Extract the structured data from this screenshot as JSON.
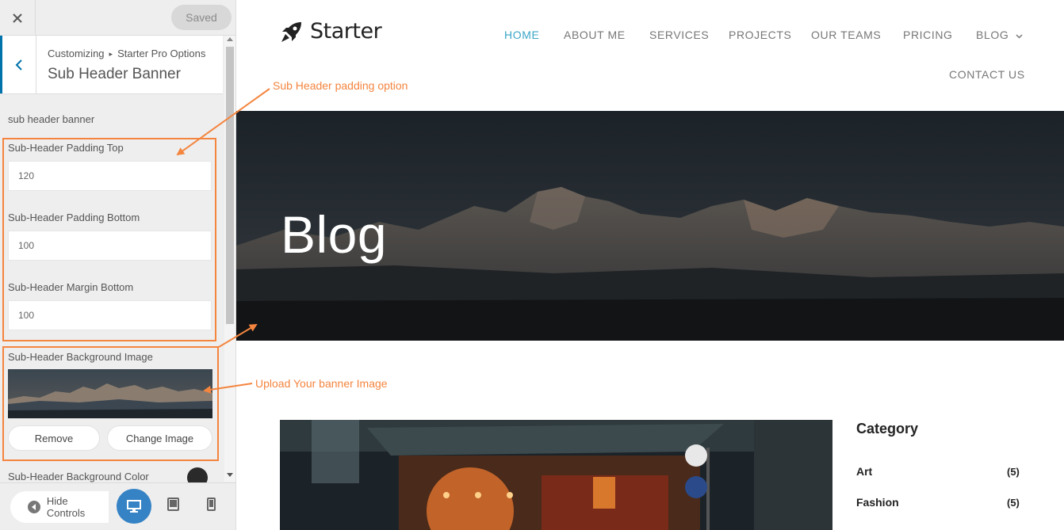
{
  "sidebar": {
    "saved_label": "Saved",
    "breadcrumb": [
      "Customizing",
      "Starter Pro Options"
    ],
    "section_title": "Sub Header Banner",
    "group_label": "sub header banner",
    "padding_top": {
      "label": "Sub-Header Padding Top",
      "value": "120"
    },
    "padding_bottom": {
      "label": "Sub-Header Padding Bottom",
      "value": "100"
    },
    "margin_bottom": {
      "label": "Sub-Header Margin Bottom",
      "value": "100"
    },
    "bg_image": {
      "label": "Sub-Header Background Image",
      "remove_label": "Remove",
      "change_label": "Change Image"
    },
    "bg_color": {
      "label": "Sub-Header Background Color",
      "value": "#2a2a2a"
    },
    "footer": {
      "hide_controls_label": "Hide Controls"
    }
  },
  "preview": {
    "logo_text": "Starter",
    "nav": [
      "HOME",
      "ABOUT ME",
      "SERVICES",
      "PROJECTS",
      "OUR TEAMS",
      "PRICING",
      "BLOG",
      "CONTACT US"
    ],
    "active_nav": "HOME",
    "banner_title": "Blog",
    "sidebar": {
      "title": "Category",
      "items": [
        {
          "name": "Art",
          "count": "(5)"
        },
        {
          "name": "Fashion",
          "count": "(5)"
        }
      ]
    }
  },
  "annotations": {
    "padding_note": "Sub Header padding option",
    "upload_note": "Upload Your banner Image"
  },
  "colors": {
    "accent": "#f4853f",
    "nav_active": "#3aa6c8",
    "customizer_blue": "#0073aa"
  }
}
